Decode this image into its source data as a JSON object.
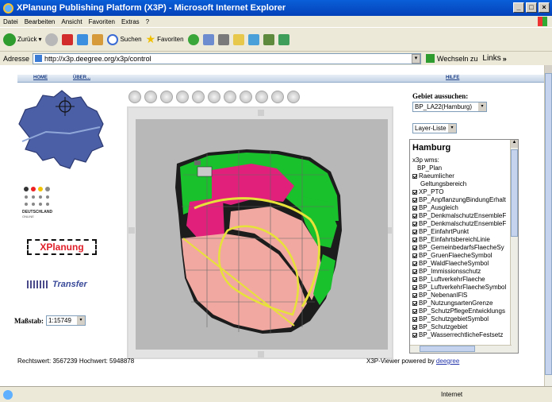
{
  "window": {
    "title": "XPlanung Publishing Platform (X3P) - Microsoft Internet Explorer"
  },
  "menu": [
    "Datei",
    "Bearbeiten",
    "Ansicht",
    "Favoriten",
    "Extras",
    "?"
  ],
  "toolbar": {
    "back": "Zurück",
    "search": "Suchen",
    "favorites": "Favoriten"
  },
  "address": {
    "label": "Adresse",
    "url": "http://x3p.deegree.org/x3p/control",
    "go": "Wechseln zu",
    "links": "Links"
  },
  "nav": {
    "home": "HOME",
    "about": "ÜBER...",
    "help": "HILFE"
  },
  "left": {
    "deutschland_line1": "DEUTSCHLAND",
    "deutschland_line2": "ONLINE",
    "xplanung_logo": "XPlanung",
    "transfer_logo": "Transfer",
    "scale_label": "Maßstab:",
    "scale_value": "1:15749"
  },
  "right": {
    "region_label": "Gebiet aussuchen:",
    "region_value": "BP_LA22(Hamburg)",
    "layer_select": "Layer-Liste",
    "panel_title": "Hamburg",
    "service": "x3p wms:",
    "root": "BP_Plan",
    "layers": [
      {
        "label": "Raeumlicher",
        "checked": true
      },
      {
        "label": "Geltungsbereich",
        "checked": false
      },
      {
        "label": "XP_PTO",
        "checked": true
      },
      {
        "label": "BP_AnpflanzungBindungErhalt",
        "checked": true
      },
      {
        "label": "BP_Ausgleich",
        "checked": true
      },
      {
        "label": "BP_DenkmalschutzEnsembleF",
        "checked": true
      },
      {
        "label": "BP_DenkmalschutzEnsembleF",
        "checked": true
      },
      {
        "label": "BP_EinfahrtPunkt",
        "checked": true
      },
      {
        "label": "BP_EinfahrtsbereichLinie",
        "checked": true
      },
      {
        "label": "BP_GemeinbedarfsFlaecheSy",
        "checked": true
      },
      {
        "label": "BP_GruenFlaecheSymbol",
        "checked": true
      },
      {
        "label": "BP_WaldFlaecheSymbol",
        "checked": true
      },
      {
        "label": "BP_Immissionsschutz",
        "checked": true
      },
      {
        "label": "BP_LuftverkehrFlaeche",
        "checked": true
      },
      {
        "label": "BP_LuftverkehrFlaecheSymbol",
        "checked": true
      },
      {
        "label": "BP_NebenanlFlS",
        "checked": true
      },
      {
        "label": "BP_NutzungsartenGrenze",
        "checked": true
      },
      {
        "label": "BP_SchutzPflegeEntwicklungs",
        "checked": true
      },
      {
        "label": "BP_SchutzgebietSymbol",
        "checked": true
      },
      {
        "label": "BP_Schutzgebiet",
        "checked": true
      },
      {
        "label": "BP_WasserrechtlicheFestsetz",
        "checked": true
      }
    ]
  },
  "footer": {
    "coords": "Rechtswert: 3567239  Hochwert: 5948878",
    "powered": "X3P-Viewer powered by",
    "deegree": "deegree"
  },
  "status": {
    "zone": "Internet"
  },
  "colors": {
    "green": "#19c12c",
    "pink": "#e0207a",
    "salmon": "#f0a8a0",
    "yellow": "#e7e23a"
  }
}
